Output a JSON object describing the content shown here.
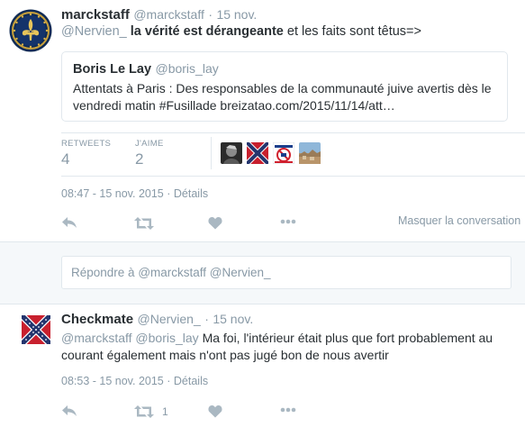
{
  "tweet": {
    "author_name": "marckstaff",
    "author_handle": "@marckstaff",
    "dot": "·",
    "date": "15 nov.",
    "mention": "@Nervien_",
    "bold_text": "la vérité est dérangeante",
    "rest_text": "et les faits sont têtus=>",
    "quote": {
      "author_name": "Boris Le Lay",
      "author_handle": "@boris_lay",
      "line1": "Attentats à Paris : Des responsables de la communauté juive avertis dès le",
      "line2": "vendredi matin #Fusillade breizatao.com/2015/11/14/att…"
    },
    "stats": {
      "retweets_label": "RETWEETS",
      "retweets_value": "4",
      "likes_label": "J'AIME",
      "likes_value": "2"
    },
    "timestamp": "08:47 - 15 nov. 2015",
    "details_sep": "·",
    "details": "Détails",
    "hide_conversation": "Masquer la conversation"
  },
  "reply_box": {
    "placeholder_prefix": "Répondre à ",
    "placeholder_mentions": "@marckstaff @Nervien_"
  },
  "reply": {
    "author_name": "Checkmate",
    "author_handle": "@Nervien_",
    "dot": "·",
    "date": "15 nov.",
    "mention1": "@marckstaff",
    "mention2": "@boris_lay",
    "line1_rest": "Ma foi, l'intérieur était plus que fort probablement au",
    "line2": "courant également mais n'ont pas jugé bon de nous avertir",
    "timestamp": "08:53 - 15 nov. 2015",
    "details_sep": "·",
    "details": "Détails",
    "retweet_count": "1"
  },
  "icons": {
    "reply": "reply-icon",
    "retweet": "retweet-icon",
    "like": "heart-icon",
    "more": "more-dots-icon"
  },
  "colors": {
    "muted": "#8899a6",
    "action": "#aab8c2",
    "text": "#292f33",
    "divider": "#e1e8ed",
    "panel_bg": "#f5f8fa"
  }
}
